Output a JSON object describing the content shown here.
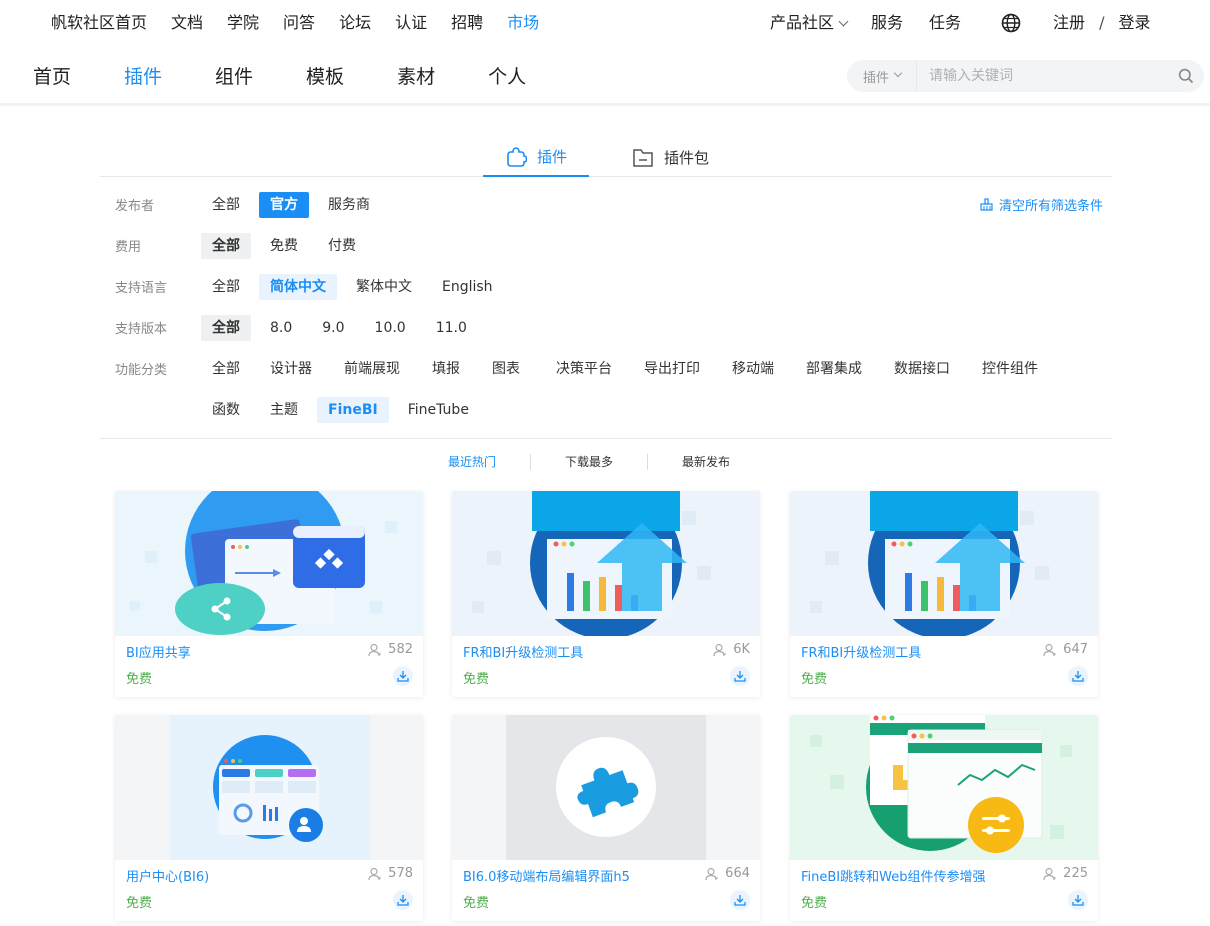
{
  "topnav": {
    "left": [
      "帆软社区首页",
      "文档",
      "学院",
      "问答",
      "论坛",
      "认证",
      "招聘",
      "市场"
    ],
    "active": "市场",
    "product_community": "产品社区",
    "service": "服务",
    "task": "任务",
    "register": "注册",
    "slash": "/",
    "login": "登录"
  },
  "subnav": {
    "items": [
      "首页",
      "插件",
      "组件",
      "模板",
      "素材",
      "个人"
    ],
    "active": "插件"
  },
  "search": {
    "scope": "插件",
    "placeholder": "请输入关键词"
  },
  "tabs": {
    "plugin": "插件",
    "plugin_pack": "插件包"
  },
  "filters": {
    "clear_label": "清空所有筛选条件",
    "rows": [
      {
        "label": "发布者",
        "options": [
          "全部",
          "官方",
          "服务商"
        ],
        "selected": "官方"
      },
      {
        "label": "费用",
        "options": [
          "全部",
          "免费",
          "付费"
        ],
        "selected": "全部"
      },
      {
        "label": "支持语言",
        "options": [
          "全部",
          "简体中文",
          "繁体中文",
          "English"
        ],
        "selected": "简体中文"
      },
      {
        "label": "支持版本",
        "options": [
          "全部",
          "8.0",
          "9.0",
          "10.0",
          "11.0"
        ],
        "selected": "全部"
      },
      {
        "label": "功能分类",
        "options": [
          "全部",
          "设计器",
          "前端展现",
          "填报",
          "图表",
          "决策平台",
          "导出打印",
          "移动端",
          "部署集成",
          "数据接口",
          "控件组件"
        ],
        "selected": ""
      },
      {
        "label": "",
        "options": [
          "函数",
          "主题",
          "FineBI",
          "FineTube"
        ],
        "selected": "FineBI"
      }
    ]
  },
  "sort": {
    "hot": "最近热门",
    "most_download": "下载最多",
    "newest": "最新发布"
  },
  "cards": [
    {
      "title": "BI应用共享",
      "downloads": "582",
      "price": "免费"
    },
    {
      "title": "FR和BI升级检测工具",
      "downloads": "6K",
      "price": "免费"
    },
    {
      "title": "FR和BI升级检测工具",
      "downloads": "647",
      "price": "免费"
    },
    {
      "title": "用户中心(BI6)",
      "downloads": "578",
      "price": "免费"
    },
    {
      "title": "BI6.0移动端布局编辑界面h5",
      "downloads": "664",
      "price": "免费"
    },
    {
      "title": "FineBI跳转和Web组件传参增强",
      "downloads": "225",
      "price": "免费"
    }
  ],
  "colors": {
    "accent": "#1b8ef5",
    "free": "#4bb04b"
  }
}
